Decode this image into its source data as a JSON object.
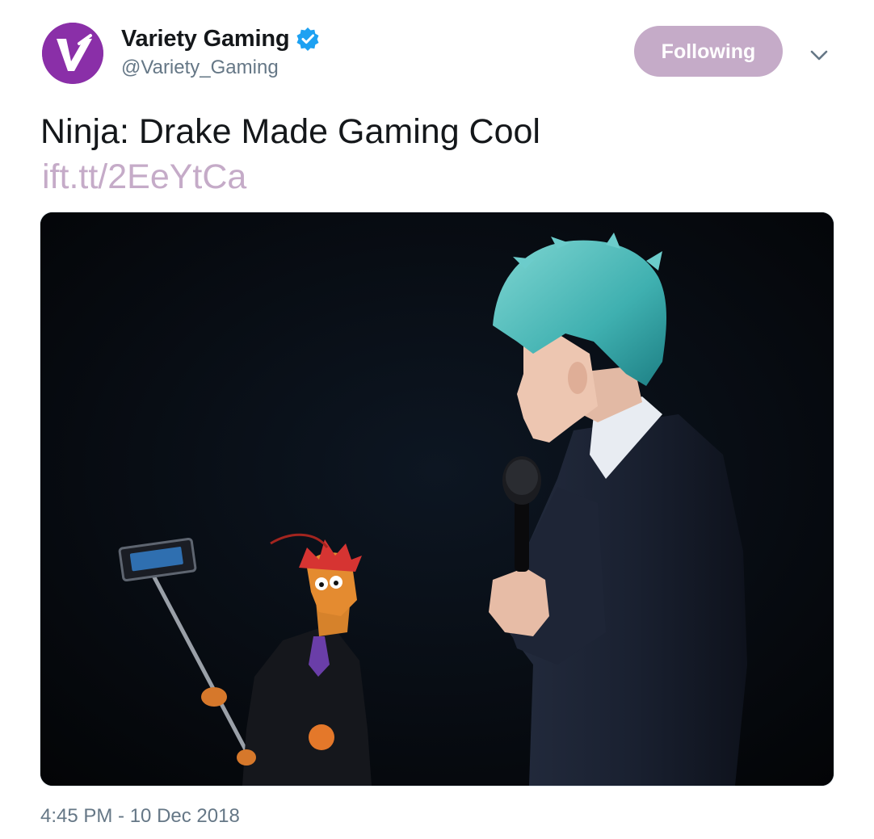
{
  "account": {
    "display_name": "Variety Gaming",
    "handle": "@Variety_Gaming",
    "verified": true,
    "avatar_icon": "variety-v-logo-icon",
    "avatar_color": "#8a2fa8"
  },
  "follow_button": {
    "label": "Following",
    "color": "#c5abc8"
  },
  "menu_icon": "chevron-down-icon",
  "tweet": {
    "text": "Ninja: Drake Made Gaming Cool",
    "link": "ift.tt/2EeYtCa",
    "link_color": "#c5abc8",
    "timestamp": "4:45 PM - 10 Dec 2018"
  },
  "media": {
    "kind": "photo"
  },
  "colors": {
    "verified_badge": "#1da1f2",
    "secondary_text": "#657786",
    "primary_text": "#14171a"
  }
}
